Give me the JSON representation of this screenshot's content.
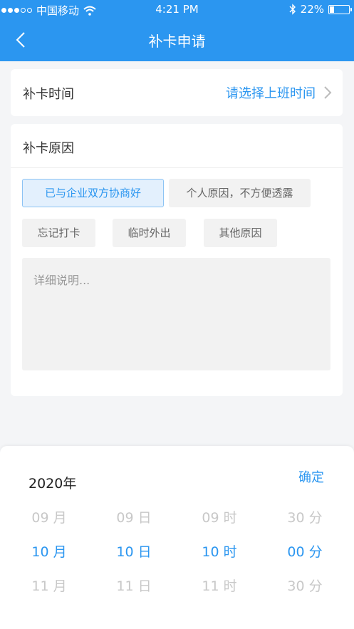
{
  "status_bar": {
    "carrier": "中国移动",
    "time": "4:21 PM",
    "battery": "22%",
    "battery_level": 0.22
  },
  "nav": {
    "title": "补卡申请"
  },
  "time_row": {
    "label": "补卡时间",
    "placeholder": "请选择上班时间"
  },
  "reason": {
    "label": "补卡原因",
    "tags": [
      "已与企业双方协商好",
      "个人原因，不方便透露",
      "忘记打卡",
      "临时外出",
      "其他原因"
    ],
    "selected_index": 0,
    "detail_placeholder": "详细说明..."
  },
  "picker": {
    "year": "2020年",
    "confirm": "确定",
    "columns": [
      {
        "prev": "09 月",
        "selected": "10 月",
        "next": "11 月"
      },
      {
        "prev": "09 日",
        "selected": "10 日",
        "next": "11 日"
      },
      {
        "prev": "09 时",
        "selected": "10 时",
        "next": "11 时"
      },
      {
        "prev": "30 分",
        "selected": "00 分",
        "next": "30 分"
      }
    ]
  },
  "colors": {
    "brand": "#2b96f0",
    "background": "#f4f5f7"
  }
}
